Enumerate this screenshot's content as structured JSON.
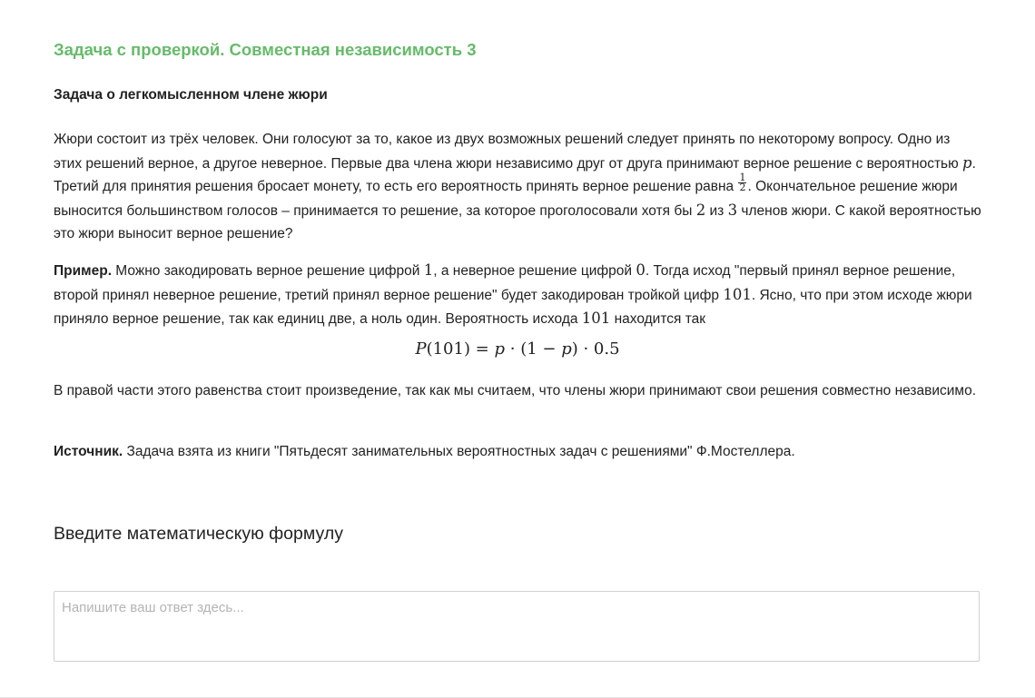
{
  "step_title": "Задача с проверкой. Совместная независимость 3",
  "task_title": "Задача о легкомысленном члене жюри",
  "problem": {
    "t1": "Жюри состоит из трёх человек. Они голосуют за то, какое из двух возможных решений следует принять по некоторому вопросу. Одно из этих решений верное, а другое неверное. Первые два члена жюри независимо друг от друга принимают верное решение с вероятностью ",
    "m_p": "p",
    "t2": ". Третий для принятия решения бросает монету, то есть его вероятность принять верное решение равна ",
    "frac_num": "1",
    "frac_den": "2",
    "t3": ". Окончательное решение жюри выносится большинством голосов – принимается то решение, за которое проголосовали хотя бы ",
    "m_2": "2",
    "t4": " из ",
    "m_3": "3",
    "t5": " членов жюри. С какой вероятностью это жюри выносит верное решение?"
  },
  "example": {
    "label": "Пример.",
    "t1": " Можно закодировать верное решение цифрой ",
    "m_1": "1",
    "t2": ", а неверное решение цифрой ",
    "m_0": "0",
    "t3": ". Тогда исход \"первый принял верное решение, второй принял неверное решение, третий принял верное решение\" будет закодирован тройкой цифр ",
    "m_101a": "101",
    "t4": ". Ясно, что при этом исходе жюри приняло верное решение, так как единиц две, а ноль один. Вероятность исхода ",
    "m_101b": "101",
    "t5": " находится так"
  },
  "formula": {
    "P": "P",
    "arg": "(101) = ",
    "p1": "p",
    "mid": " · (1 − ",
    "p2": "p",
    "end": ") · 0.5"
  },
  "explanation": "В правой части этого равенства стоит произведение, так как мы считаем, что члены жюри принимают свои решения совместно независимо.",
  "source": {
    "label": "Источник.",
    "text": " Задача взята из книги \"Пятьдесят занимательных вероятностных задач с решениями\" Ф.Мостеллера."
  },
  "answer": {
    "heading": "Введите математическую формулу",
    "placeholder": "Напишите ваш ответ здесь...",
    "value": ""
  },
  "colors": {
    "accent": "#66bb6a",
    "text": "#222222",
    "border": "#d0d0d0",
    "placeholder": "#b4b4b4"
  }
}
